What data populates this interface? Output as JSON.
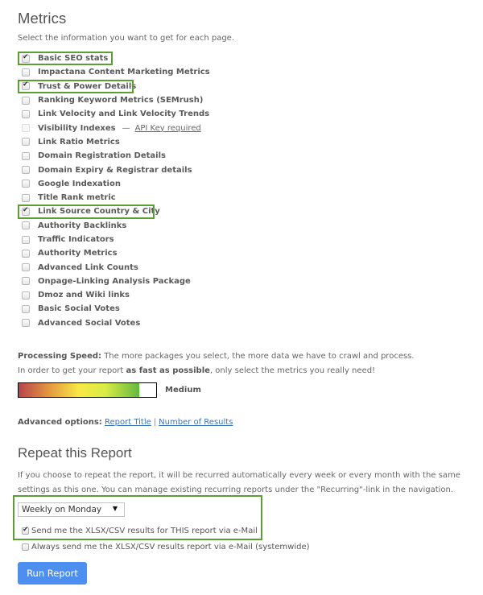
{
  "metrics_section": {
    "title": "Metrics",
    "intro": "Select the information you want to get for each page.",
    "items": [
      {
        "label": "Basic SEO stats",
        "checked": true,
        "highlighted": true
      },
      {
        "label": "Impactana Content Marketing Metrics",
        "checked": false
      },
      {
        "label": "Trust & Power Details",
        "checked": true,
        "highlighted": true
      },
      {
        "label": "Ranking Keyword Metrics (SEMrush)",
        "checked": false
      },
      {
        "label": "Link Velocity and Link Velocity Trends",
        "checked": false
      },
      {
        "label": "Visibility Indexes",
        "checked": false,
        "disabled": true,
        "separator": "—",
        "link": "API Key required"
      },
      {
        "label": "Link Ratio Metrics",
        "checked": false
      },
      {
        "label": "Domain Registration Details",
        "checked": false
      },
      {
        "label": "Domain Expiry & Registrar details",
        "checked": false
      },
      {
        "label": "Google Indexation",
        "checked": false
      },
      {
        "label": "Title Rank metric",
        "checked": false
      },
      {
        "label": "Link Source Country & City",
        "checked": true,
        "highlighted": true
      },
      {
        "label": "Authority Backlinks",
        "checked": false
      },
      {
        "label": "Traffic Indicators",
        "checked": false
      },
      {
        "label": "Authority Metrics",
        "checked": false
      },
      {
        "label": "Advanced Link Counts",
        "checked": false
      },
      {
        "label": "Onpage-Linking Analysis Package",
        "checked": false
      },
      {
        "label": "Dmoz and Wiki links",
        "checked": false
      },
      {
        "label": "Basic Social Votes",
        "checked": false
      },
      {
        "label": "Advanced Social Votes",
        "checked": false
      }
    ]
  },
  "processing": {
    "label": "Processing Speed:",
    "line1": " The more packages you select, the more data we have to crawl and process.",
    "line2_pre": "In order to get your report ",
    "line2_bold": "as fast as possible",
    "line2_post": ", only select the metrics you really need!",
    "speed_fraction": 0.88,
    "speed_label": "Medium"
  },
  "advanced": {
    "label": "Advanced options:",
    "link1": "Report Title",
    "separator": "|",
    "link2": "Number of Results"
  },
  "repeat": {
    "title": "Repeat this Report",
    "description": "If you choose to repeat the report, it will be recurred automatically every week or every month with the same settings as this one. You can manage existing recurring reports under the \"Recurring\"-link in the navigation.",
    "select_value": "Weekly on Monday",
    "select_arrow": "▼",
    "option1": {
      "label": "Send me the XLSX/CSV results for THIS report via e-Mail",
      "checked": true
    },
    "option2": {
      "label": "Always send me the XLSX/CSV results report via e-Mail (systemwide)",
      "checked": false
    }
  },
  "run_button": "Run Report",
  "colors": {
    "highlight": "#5c9e31",
    "button": "#4d8ff0",
    "link": "#3b74b8"
  }
}
